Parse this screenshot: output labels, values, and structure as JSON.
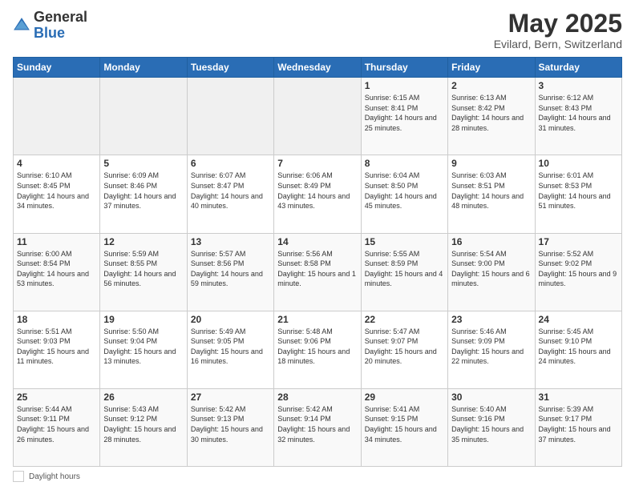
{
  "logo": {
    "general": "General",
    "blue": "Blue"
  },
  "title": "May 2025",
  "subtitle": "Evilard, Bern, Switzerland",
  "weekdays": [
    "Sunday",
    "Monday",
    "Tuesday",
    "Wednesday",
    "Thursday",
    "Friday",
    "Saturday"
  ],
  "footer": {
    "label": "Daylight hours"
  },
  "weeks": [
    [
      {
        "day": "",
        "sunrise": "",
        "sunset": "",
        "daylight": "",
        "empty": true
      },
      {
        "day": "",
        "sunrise": "",
        "sunset": "",
        "daylight": "",
        "empty": true
      },
      {
        "day": "",
        "sunrise": "",
        "sunset": "",
        "daylight": "",
        "empty": true
      },
      {
        "day": "",
        "sunrise": "",
        "sunset": "",
        "daylight": "",
        "empty": true
      },
      {
        "day": "1",
        "sunrise": "Sunrise: 6:15 AM",
        "sunset": "Sunset: 8:41 PM",
        "daylight": "Daylight: 14 hours and 25 minutes.",
        "empty": false
      },
      {
        "day": "2",
        "sunrise": "Sunrise: 6:13 AM",
        "sunset": "Sunset: 8:42 PM",
        "daylight": "Daylight: 14 hours and 28 minutes.",
        "empty": false
      },
      {
        "day": "3",
        "sunrise": "Sunrise: 6:12 AM",
        "sunset": "Sunset: 8:43 PM",
        "daylight": "Daylight: 14 hours and 31 minutes.",
        "empty": false
      }
    ],
    [
      {
        "day": "4",
        "sunrise": "Sunrise: 6:10 AM",
        "sunset": "Sunset: 8:45 PM",
        "daylight": "Daylight: 14 hours and 34 minutes.",
        "empty": false
      },
      {
        "day": "5",
        "sunrise": "Sunrise: 6:09 AM",
        "sunset": "Sunset: 8:46 PM",
        "daylight": "Daylight: 14 hours and 37 minutes.",
        "empty": false
      },
      {
        "day": "6",
        "sunrise": "Sunrise: 6:07 AM",
        "sunset": "Sunset: 8:47 PM",
        "daylight": "Daylight: 14 hours and 40 minutes.",
        "empty": false
      },
      {
        "day": "7",
        "sunrise": "Sunrise: 6:06 AM",
        "sunset": "Sunset: 8:49 PM",
        "daylight": "Daylight: 14 hours and 43 minutes.",
        "empty": false
      },
      {
        "day": "8",
        "sunrise": "Sunrise: 6:04 AM",
        "sunset": "Sunset: 8:50 PM",
        "daylight": "Daylight: 14 hours and 45 minutes.",
        "empty": false
      },
      {
        "day": "9",
        "sunrise": "Sunrise: 6:03 AM",
        "sunset": "Sunset: 8:51 PM",
        "daylight": "Daylight: 14 hours and 48 minutes.",
        "empty": false
      },
      {
        "day": "10",
        "sunrise": "Sunrise: 6:01 AM",
        "sunset": "Sunset: 8:53 PM",
        "daylight": "Daylight: 14 hours and 51 minutes.",
        "empty": false
      }
    ],
    [
      {
        "day": "11",
        "sunrise": "Sunrise: 6:00 AM",
        "sunset": "Sunset: 8:54 PM",
        "daylight": "Daylight: 14 hours and 53 minutes.",
        "empty": false
      },
      {
        "day": "12",
        "sunrise": "Sunrise: 5:59 AM",
        "sunset": "Sunset: 8:55 PM",
        "daylight": "Daylight: 14 hours and 56 minutes.",
        "empty": false
      },
      {
        "day": "13",
        "sunrise": "Sunrise: 5:57 AM",
        "sunset": "Sunset: 8:56 PM",
        "daylight": "Daylight: 14 hours and 59 minutes.",
        "empty": false
      },
      {
        "day": "14",
        "sunrise": "Sunrise: 5:56 AM",
        "sunset": "Sunset: 8:58 PM",
        "daylight": "Daylight: 15 hours and 1 minute.",
        "empty": false
      },
      {
        "day": "15",
        "sunrise": "Sunrise: 5:55 AM",
        "sunset": "Sunset: 8:59 PM",
        "daylight": "Daylight: 15 hours and 4 minutes.",
        "empty": false
      },
      {
        "day": "16",
        "sunrise": "Sunrise: 5:54 AM",
        "sunset": "Sunset: 9:00 PM",
        "daylight": "Daylight: 15 hours and 6 minutes.",
        "empty": false
      },
      {
        "day": "17",
        "sunrise": "Sunrise: 5:52 AM",
        "sunset": "Sunset: 9:02 PM",
        "daylight": "Daylight: 15 hours and 9 minutes.",
        "empty": false
      }
    ],
    [
      {
        "day": "18",
        "sunrise": "Sunrise: 5:51 AM",
        "sunset": "Sunset: 9:03 PM",
        "daylight": "Daylight: 15 hours and 11 minutes.",
        "empty": false
      },
      {
        "day": "19",
        "sunrise": "Sunrise: 5:50 AM",
        "sunset": "Sunset: 9:04 PM",
        "daylight": "Daylight: 15 hours and 13 minutes.",
        "empty": false
      },
      {
        "day": "20",
        "sunrise": "Sunrise: 5:49 AM",
        "sunset": "Sunset: 9:05 PM",
        "daylight": "Daylight: 15 hours and 16 minutes.",
        "empty": false
      },
      {
        "day": "21",
        "sunrise": "Sunrise: 5:48 AM",
        "sunset": "Sunset: 9:06 PM",
        "daylight": "Daylight: 15 hours and 18 minutes.",
        "empty": false
      },
      {
        "day": "22",
        "sunrise": "Sunrise: 5:47 AM",
        "sunset": "Sunset: 9:07 PM",
        "daylight": "Daylight: 15 hours and 20 minutes.",
        "empty": false
      },
      {
        "day": "23",
        "sunrise": "Sunrise: 5:46 AM",
        "sunset": "Sunset: 9:09 PM",
        "daylight": "Daylight: 15 hours and 22 minutes.",
        "empty": false
      },
      {
        "day": "24",
        "sunrise": "Sunrise: 5:45 AM",
        "sunset": "Sunset: 9:10 PM",
        "daylight": "Daylight: 15 hours and 24 minutes.",
        "empty": false
      }
    ],
    [
      {
        "day": "25",
        "sunrise": "Sunrise: 5:44 AM",
        "sunset": "Sunset: 9:11 PM",
        "daylight": "Daylight: 15 hours and 26 minutes.",
        "empty": false
      },
      {
        "day": "26",
        "sunrise": "Sunrise: 5:43 AM",
        "sunset": "Sunset: 9:12 PM",
        "daylight": "Daylight: 15 hours and 28 minutes.",
        "empty": false
      },
      {
        "day": "27",
        "sunrise": "Sunrise: 5:42 AM",
        "sunset": "Sunset: 9:13 PM",
        "daylight": "Daylight: 15 hours and 30 minutes.",
        "empty": false
      },
      {
        "day": "28",
        "sunrise": "Sunrise: 5:42 AM",
        "sunset": "Sunset: 9:14 PM",
        "daylight": "Daylight: 15 hours and 32 minutes.",
        "empty": false
      },
      {
        "day": "29",
        "sunrise": "Sunrise: 5:41 AM",
        "sunset": "Sunset: 9:15 PM",
        "daylight": "Daylight: 15 hours and 34 minutes.",
        "empty": false
      },
      {
        "day": "30",
        "sunrise": "Sunrise: 5:40 AM",
        "sunset": "Sunset: 9:16 PM",
        "daylight": "Daylight: 15 hours and 35 minutes.",
        "empty": false
      },
      {
        "day": "31",
        "sunrise": "Sunrise: 5:39 AM",
        "sunset": "Sunset: 9:17 PM",
        "daylight": "Daylight: 15 hours and 37 minutes.",
        "empty": false
      }
    ]
  ]
}
